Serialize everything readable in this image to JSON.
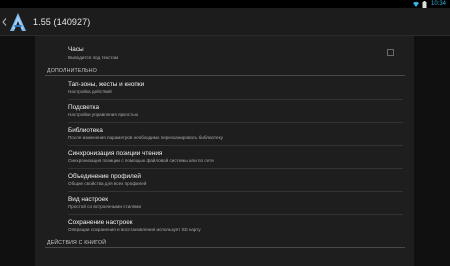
{
  "status_bar": {
    "time": "10:34",
    "icons": [
      "wifi-icon",
      "battery-icon"
    ]
  },
  "action_bar": {
    "title": "1.55 (140927)",
    "icons": [
      "back-chevron-icon",
      "app-logo-icon"
    ]
  },
  "clock_pref": {
    "title": "Часы",
    "summary": "Выводится под текстом",
    "checked": false
  },
  "sections": {
    "additional": "ДОПОЛНИТЕЛЬНО",
    "book_actions": "ДЕЙСТВИЯ С КНИГОЙ"
  },
  "prefs": [
    {
      "title": "Тап-зоны, жесты и кнопки",
      "summary": "Настройка действий"
    },
    {
      "title": "Подсветка",
      "summary": "Настройки управления яркостью"
    },
    {
      "title": "Библиотека",
      "summary": "После изменения параметров необходимо пересканировать библиотеку"
    },
    {
      "title": "Синхронизация позиции чтения",
      "summary": "Синхронизация позиции с помощью файловой системы или по сети"
    },
    {
      "title": "Объединение профилей",
      "summary": "Общие свойства для всех профилей"
    },
    {
      "title": "Вид настроек",
      "summary": "Простой со встроенными стилями"
    },
    {
      "title": "Сохранение настроек",
      "summary": "Операции сохранения и восстановления использует SD карту"
    }
  ],
  "colors": {
    "accent": "#33b5e5",
    "panel": "#1e1e1e",
    "background": "#101010"
  }
}
